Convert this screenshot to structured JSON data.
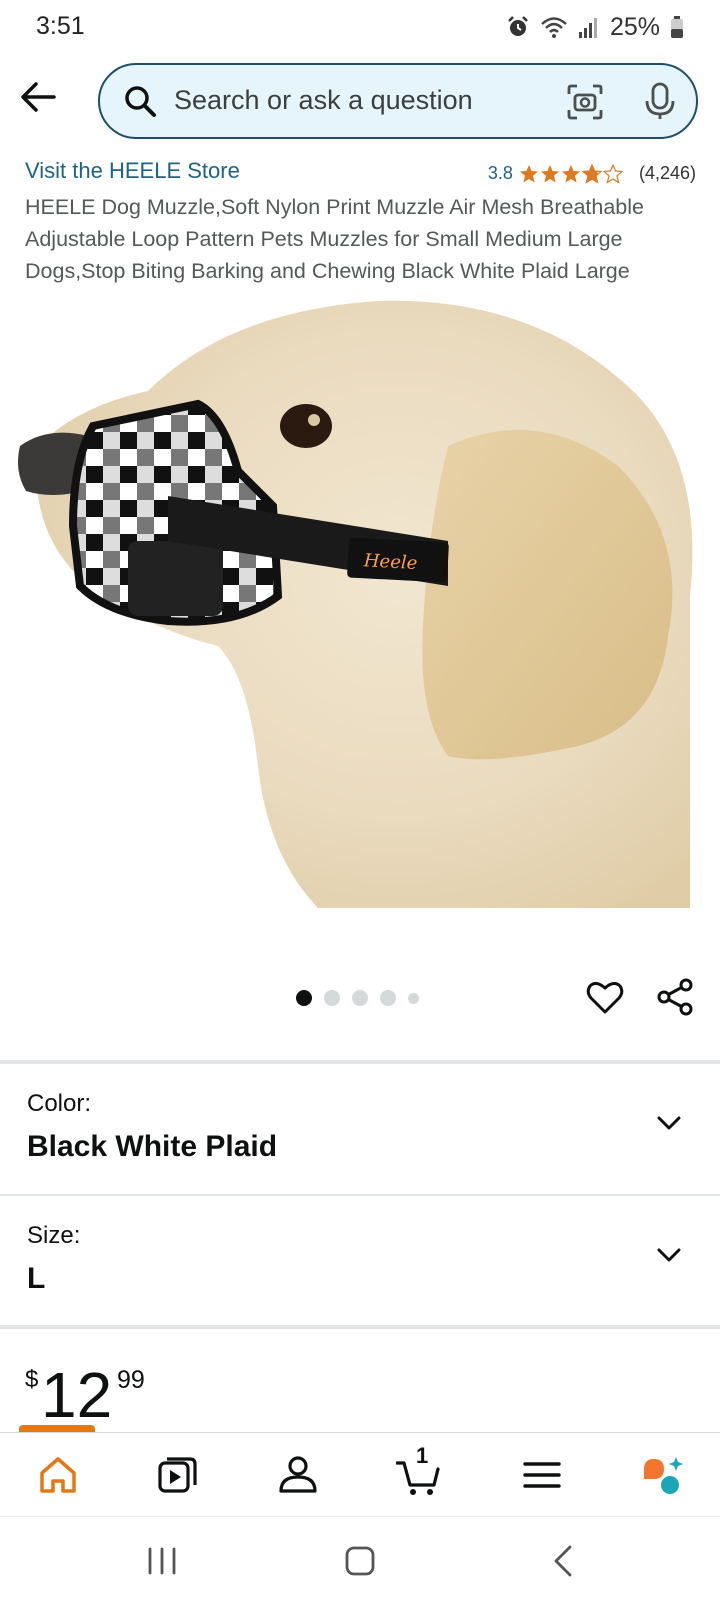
{
  "status_bar": {
    "time": "3:51",
    "battery": "25%"
  },
  "search": {
    "placeholder": "Search or ask a question"
  },
  "product": {
    "store_link": "Visit the HEELE Store",
    "rating": "3.8",
    "rating_stars": 3.8,
    "rating_count": "(4,246)",
    "title": "HEELE Dog Muzzle,Soft Nylon Print Muzzle Air Mesh Breathable Adjustable Loop Pattern Pets Muzzles for Small Medium Large Dogs,Stop Biting Barking and Chewing Black White Plaid Large",
    "image_logo_text": "Heele",
    "carousel_total": 5,
    "carousel_current": 1
  },
  "variations": {
    "color_label": "Color:",
    "color_value": "Black White Plaid",
    "size_label": "Size:",
    "size_value": "L"
  },
  "price": {
    "symbol": "$",
    "whole": "12",
    "fraction": "99"
  },
  "bottom_nav": {
    "items": [
      "home-icon",
      "video-icon",
      "account-icon",
      "cart-icon",
      "menu-icon",
      "rufus-icon"
    ],
    "active": "home-icon",
    "cart_count": "1"
  },
  "colors": {
    "accent": "#e47911",
    "link": "#1f6384",
    "star": "#de7921",
    "search_bg": "#e6f4fb",
    "search_border": "#1d4f6b"
  }
}
